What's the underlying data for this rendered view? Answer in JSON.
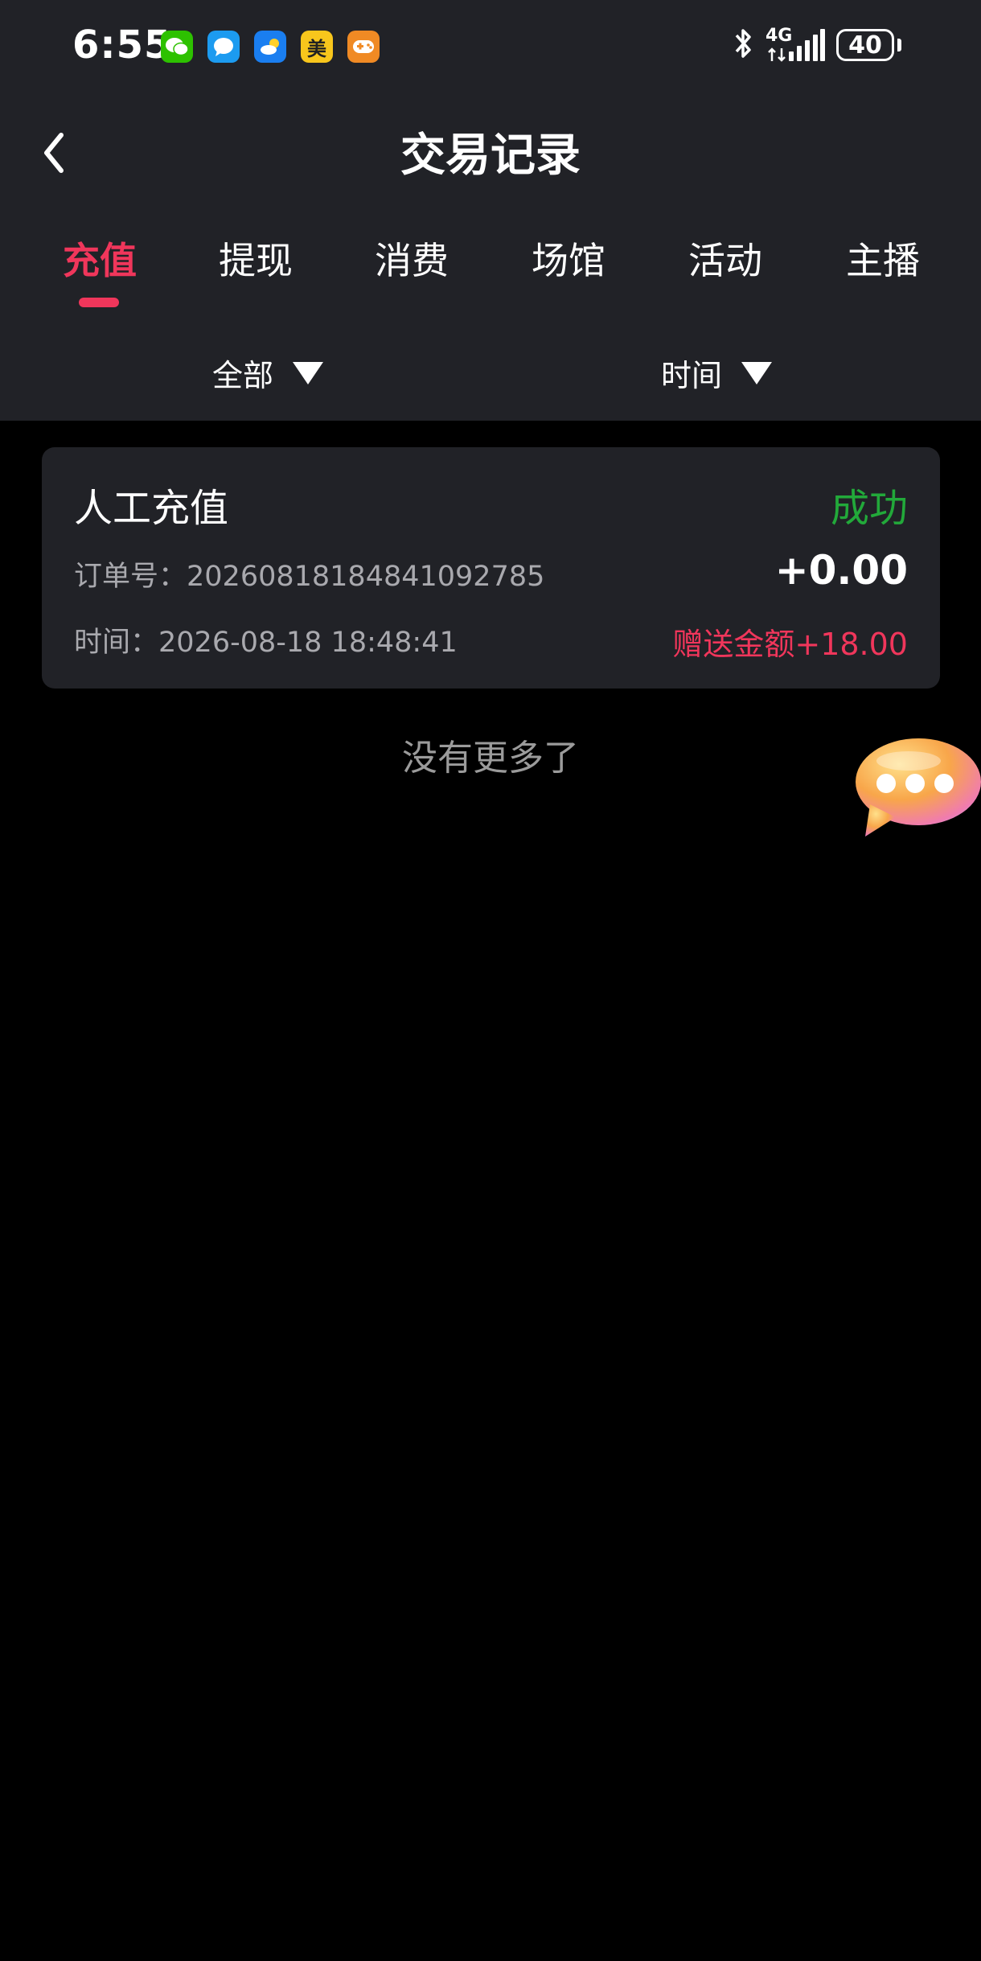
{
  "status_bar": {
    "time": "6:55",
    "apps": [
      {
        "icon": "wechat-icon",
        "color": "#2dc100"
      },
      {
        "icon": "message-icon",
        "color": "#1c9bf0"
      },
      {
        "icon": "weather-icon",
        "color": "#1a7ef0"
      },
      {
        "icon": "meituan-icon",
        "label": "美",
        "color": "#f8c61c"
      },
      {
        "icon": "game-icon",
        "color": "#f08a24"
      }
    ],
    "network": "4G",
    "battery": "40"
  },
  "nav": {
    "title": "交易记录"
  },
  "tabs": [
    {
      "label": "充值",
      "active": true
    },
    {
      "label": "提现"
    },
    {
      "label": "消费"
    },
    {
      "label": "场馆"
    },
    {
      "label": "活动"
    },
    {
      "label": "主播"
    }
  ],
  "filters": {
    "type": "全部",
    "time": "时间"
  },
  "records": [
    {
      "title": "人工充值",
      "status": "成功",
      "order_label": "订单号：",
      "order_no": "20260818184841092785",
      "amount": "+0.00",
      "time_label": "时间：",
      "time": "2026-08-18 18:48:41",
      "bonus": "赠送金额+18.00"
    }
  ],
  "no_more": "没有更多了",
  "colors": {
    "accent": "#f0365b",
    "success": "#22a93a",
    "header_bg": "#212227",
    "page_bg": "#000000"
  }
}
